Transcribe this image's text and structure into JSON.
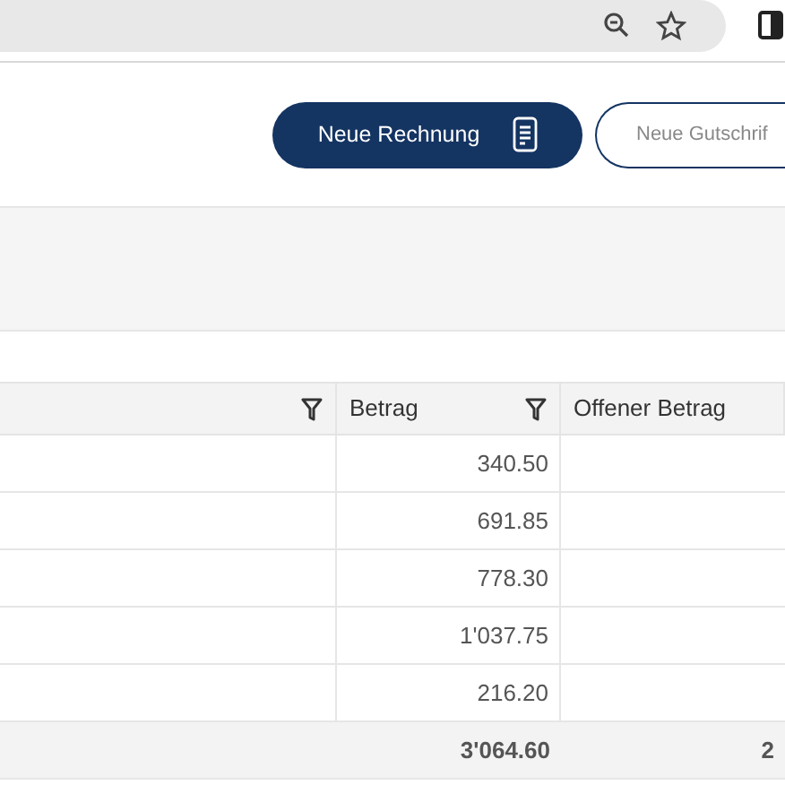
{
  "toolbar": {
    "buttons": [
      {
        "label": "Neue Rechnung",
        "kind": "primary"
      },
      {
        "label": "Neue Gutschrif",
        "kind": "outline"
      }
    ]
  },
  "table": {
    "columns": [
      {
        "filter": true
      },
      {
        "label": "Betrag",
        "filter": true
      },
      {
        "label": "Offener Betrag",
        "filter": false
      }
    ],
    "rows": [
      {
        "betrag": "340.50"
      },
      {
        "betrag": "691.85"
      },
      {
        "betrag": "778.30"
      },
      {
        "betrag": "1'037.75"
      },
      {
        "betrag": "216.20"
      }
    ],
    "total": {
      "betrag": "3'064.60",
      "offener_betrag": "2"
    }
  }
}
